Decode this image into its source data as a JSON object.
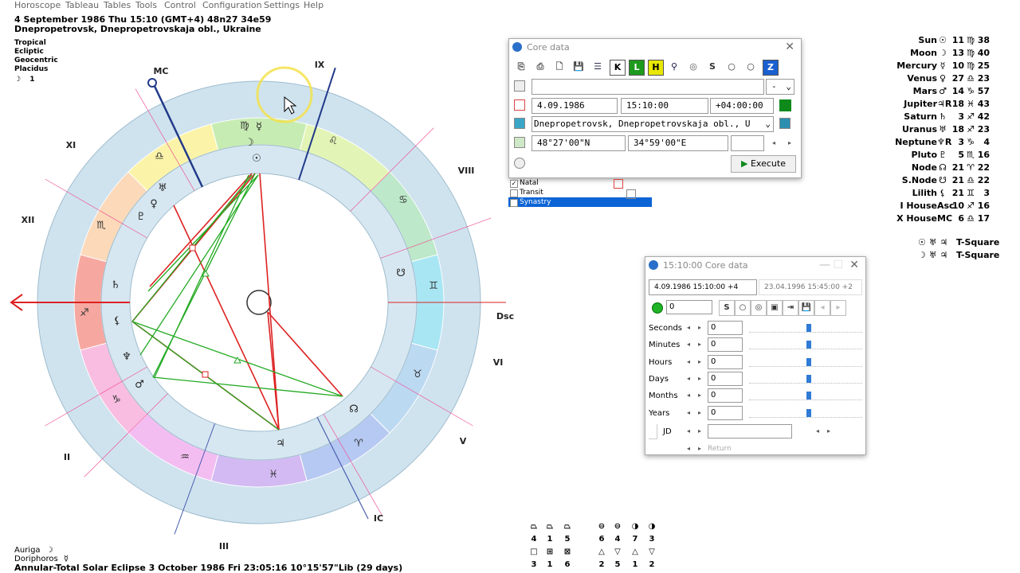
{
  "menu": [
    "Horoscope",
    "Tableau",
    "Tables",
    "Tools",
    "Control",
    "Configuration",
    "Settings",
    "Help"
  ],
  "header": {
    "line1": "4 September 1986  Thu  15:10 (GMT+4) 48n27  34e59",
    "line2": "Dnepropetrovsk, Dnepropetrovskaja obl., Ukraine",
    "settings": [
      "Tropical",
      "Ecliptic",
      "Geocentric",
      "Placidus"
    ],
    "moon_flag": "☽",
    "moon_flag_value": "1"
  },
  "chart": {
    "angle_labels": {
      "mc": "MC",
      "ic": "IC",
      "dsc": "Dsc"
    },
    "house_labels": [
      "IX",
      "XI",
      "XII",
      "II",
      "III",
      "V",
      "VI"
    ],
    "sign_glyphs": [
      "♍",
      "♌",
      "♋",
      "♊",
      "♉",
      "♈",
      "♓",
      "♒",
      "♑",
      "♐",
      "♏",
      "♎"
    ],
    "planet_glyphs": {
      "sun": "☉",
      "moon": "☽",
      "mercury": "☿",
      "venus": "♀",
      "mars": "♂",
      "jupiter": "♃",
      "saturn": "♄",
      "uranus": "♅",
      "neptune": "♆",
      "pluto": "♇",
      "node": "☊",
      "snode": "☋",
      "lilith": "⚸"
    },
    "retro_mark": "R"
  },
  "planets": [
    {
      "name": "Sun",
      "glyph": "☉",
      "deg": "11",
      "sign": "♍",
      "min": "38"
    },
    {
      "name": "Moon",
      "glyph": "☽",
      "deg": "13",
      "sign": "♍",
      "min": "40"
    },
    {
      "name": "Mercury",
      "glyph": "☿",
      "deg": "10",
      "sign": "♍",
      "min": "25"
    },
    {
      "name": "Venus",
      "glyph": "♀",
      "deg": "27",
      "sign": "♎",
      "min": "23"
    },
    {
      "name": "Mars",
      "glyph": "♂",
      "deg": "14",
      "sign": "♑",
      "min": "57"
    },
    {
      "name": "Jupiter",
      "glyph": "♃R",
      "deg": "18",
      "sign": "♓",
      "min": "43"
    },
    {
      "name": "Saturn",
      "glyph": "♄",
      "deg": "3",
      "sign": "♐",
      "min": "42"
    },
    {
      "name": "Uranus",
      "glyph": "♅",
      "deg": "18",
      "sign": "♐",
      "min": "23"
    },
    {
      "name": "Neptune",
      "glyph": "♆R",
      "deg": "3",
      "sign": "♑",
      "min": "4"
    },
    {
      "name": "Pluto",
      "glyph": "♇",
      "deg": "5",
      "sign": "♏",
      "min": "16"
    },
    {
      "name": "Node",
      "glyph": "☊",
      "deg": "21",
      "sign": "♈",
      "min": "22"
    },
    {
      "name": "S.Node",
      "glyph": "☋",
      "deg": "21",
      "sign": "♎",
      "min": "22"
    },
    {
      "name": "Lilith",
      "glyph": "⚸",
      "deg": "21",
      "sign": "♊",
      "min": "3"
    },
    {
      "name": "I House",
      "glyph": "Asc",
      "deg": "10",
      "sign": "♐",
      "min": "16"
    },
    {
      "name": "X House",
      "glyph": "MC",
      "deg": "6",
      "sign": "♎",
      "min": "17"
    }
  ],
  "aspect_patterns": [
    {
      "glyphs": "☉ ♅ ♃",
      "name": "T-Square"
    },
    {
      "glyphs": "☽ ♅ ♃",
      "name": "T-Square"
    }
  ],
  "core_data": {
    "title": "Core data",
    "toolbar": [
      "⎘",
      "⎙",
      "🗋",
      "💾",
      "☰",
      "K",
      "L",
      "H",
      "⚲",
      "◎",
      "S",
      "○",
      "○",
      "Z"
    ],
    "name_value": "",
    "name_select": "-",
    "date": "4.09.1986",
    "time": "15:10:00",
    "zone": "+04:00:00",
    "place": "Dnepropetrovsk, Dnepropetrovskaja obl., U",
    "lat": "48°27'00\"N",
    "lon": "34°59'00\"E",
    "execute": "Execute"
  },
  "chart_list": [
    {
      "label": "Natal",
      "checked": true,
      "selected": false
    },
    {
      "label": "Transit",
      "checked": false,
      "selected": false
    },
    {
      "label": "Synastry",
      "checked": false,
      "selected": true
    }
  ],
  "time_window": {
    "title": "15:10:00 Core data",
    "current": "4.09.1986  15:10:00  +4",
    "other": "23.04.1996   15:45:00  +2",
    "step_value": "0",
    "rows": [
      {
        "label": "Seconds",
        "value": "0"
      },
      {
        "label": "Minutes",
        "value": "0"
      },
      {
        "label": "Hours",
        "value": "0"
      },
      {
        "label": "Days",
        "value": "0"
      },
      {
        "label": "Months",
        "value": "0"
      },
      {
        "label": "Years",
        "value": "0"
      }
    ],
    "jd_label": "JD",
    "jd_value": "",
    "return_label": "Return"
  },
  "bottom": {
    "star1_name": "Auriga",
    "star1_glyph": "☽",
    "star2_name": "Doriphoros",
    "star2_glyph": "☿",
    "eclipse": "Annular-Total Solar Eclipse 3 October 1986 Fri 23:05:16 10°15'57\"Lib (29 days)"
  },
  "aspect_grid": {
    "top_symbols": [
      "⏢",
      "⏢",
      "⏢",
      "⊖",
      "⊖",
      "◑",
      "◑"
    ],
    "top_counts": [
      "4",
      "1",
      "5",
      "6",
      "4",
      "7",
      "3"
    ],
    "bottom_symbols": [
      "□",
      "⊞",
      "⊠",
      "△",
      "▽",
      "△",
      "▽"
    ],
    "bottom_counts": [
      "3",
      "1",
      "6",
      "2",
      "5",
      "1",
      "2"
    ]
  }
}
